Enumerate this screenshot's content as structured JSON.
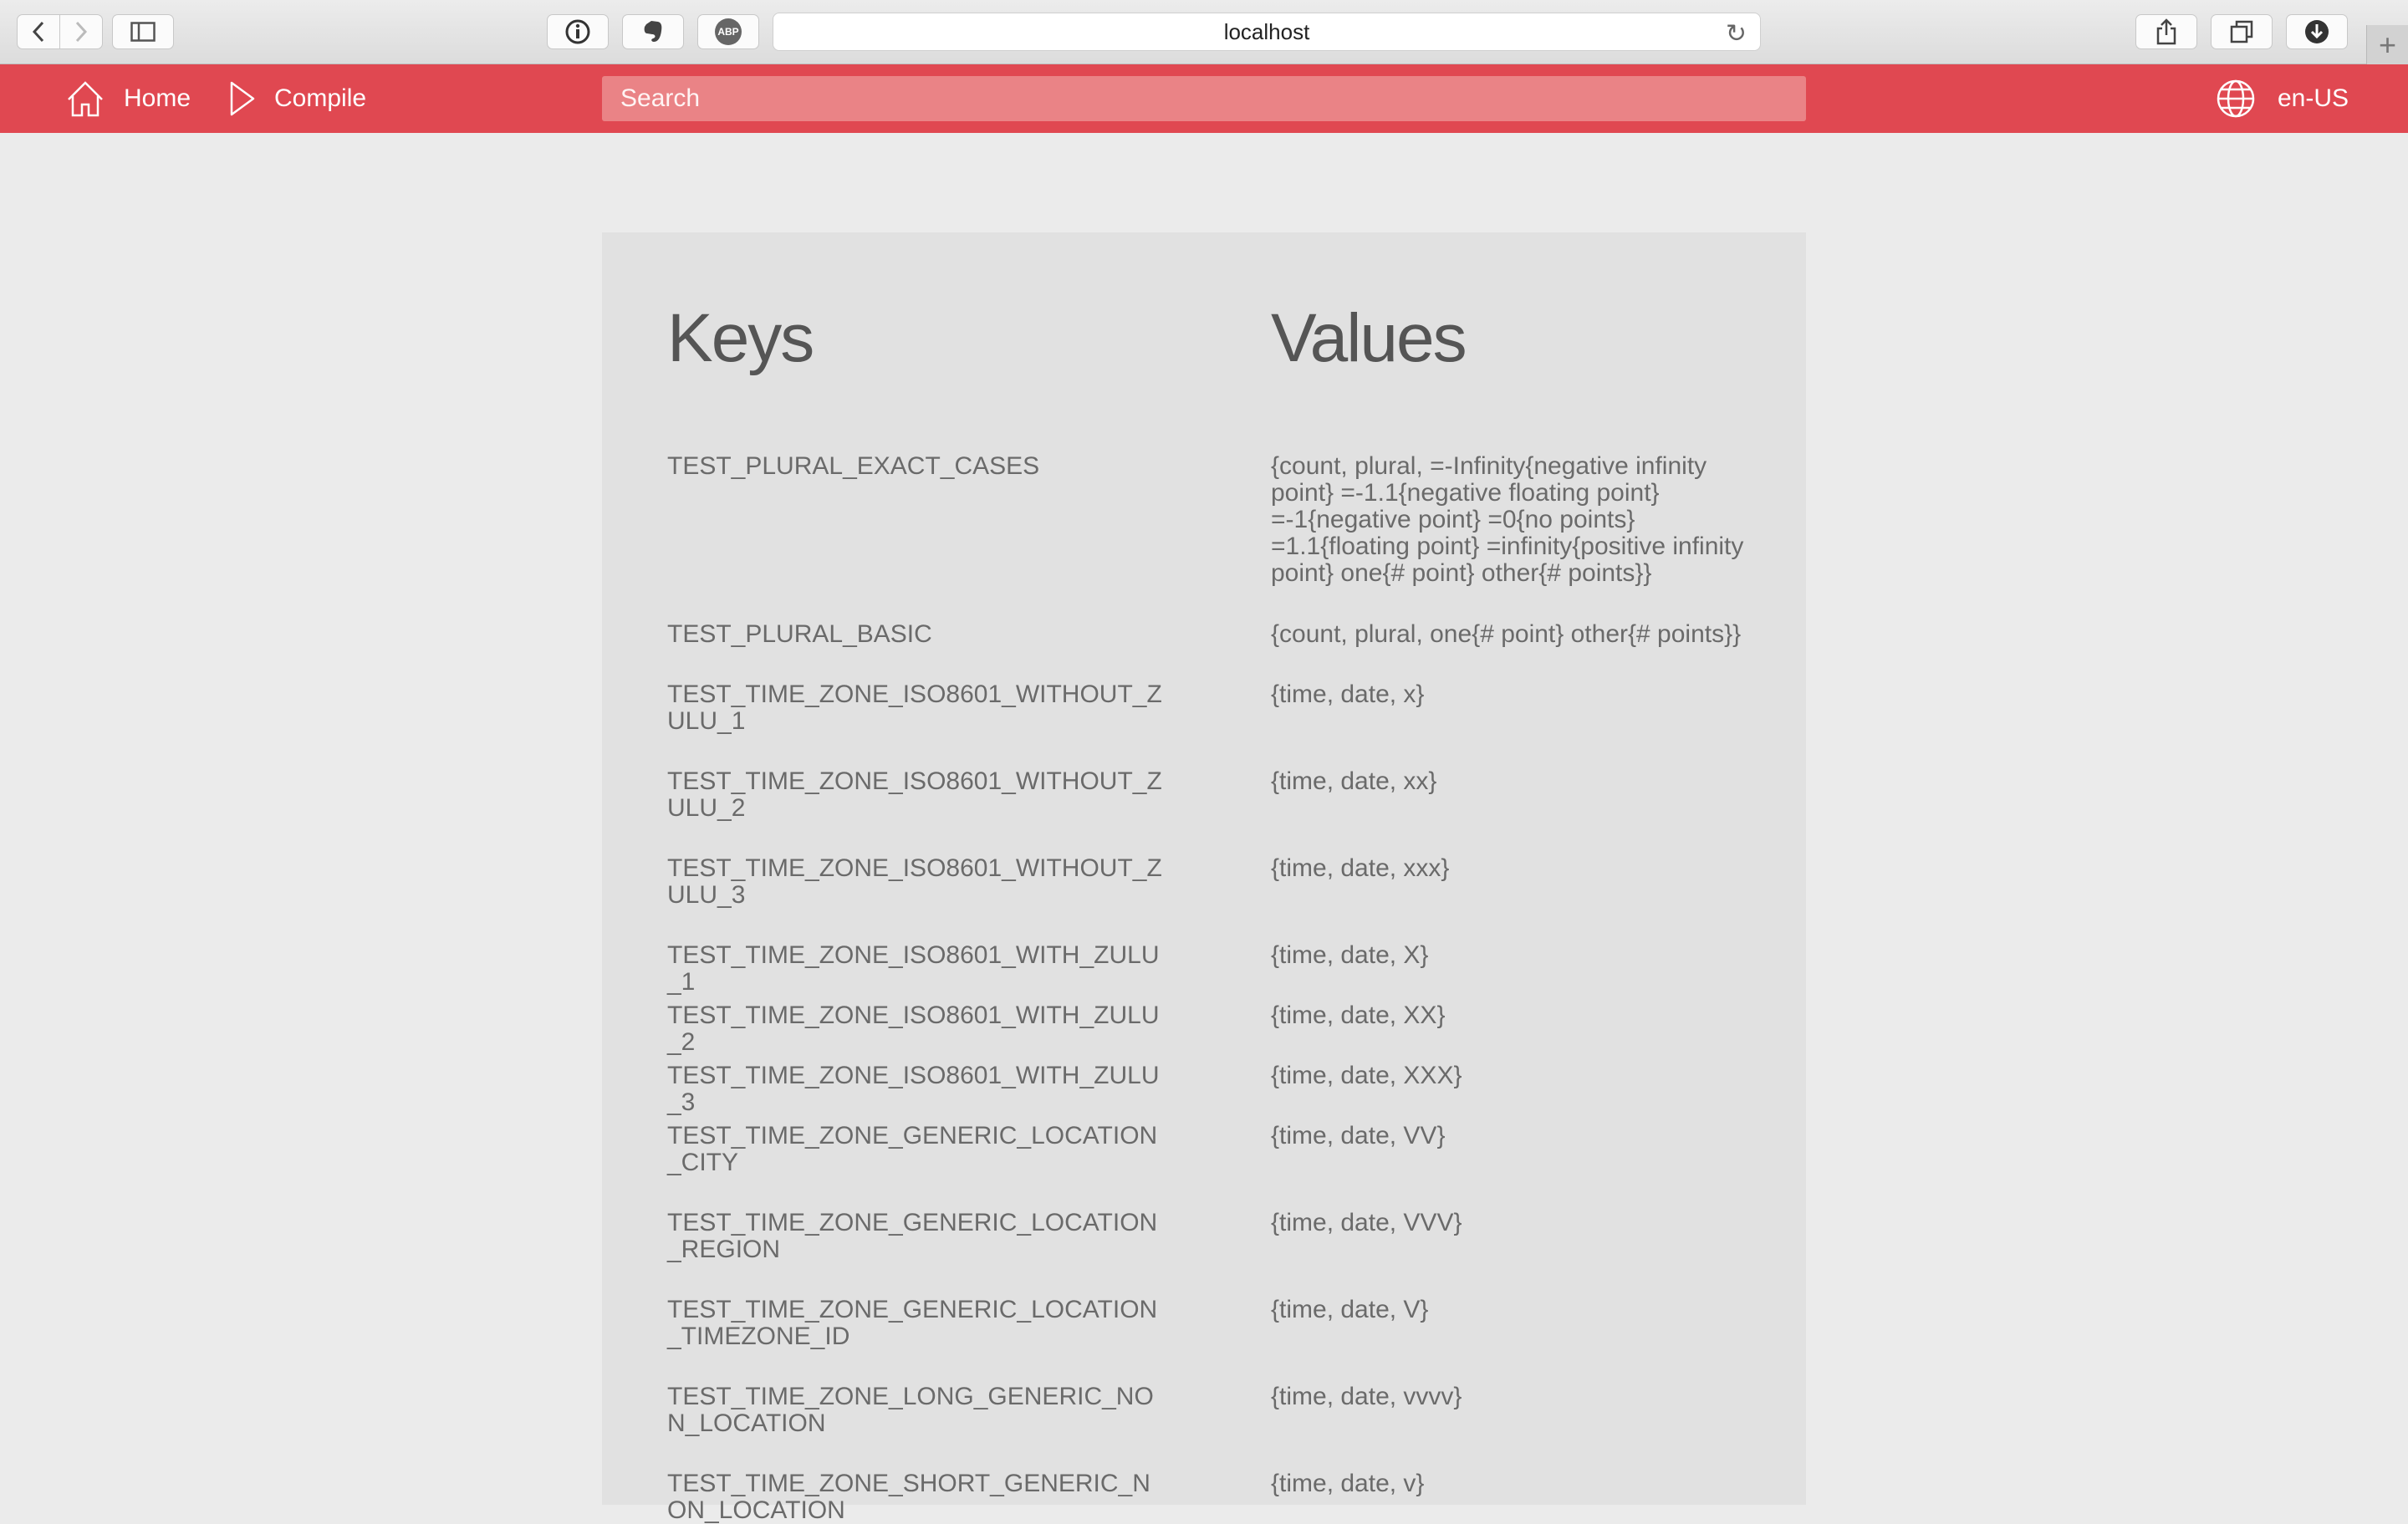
{
  "browser": {
    "address": "localhost",
    "adblock_label": "ABP"
  },
  "navbar": {
    "home_label": "Home",
    "compile_label": "Compile",
    "search_placeholder": "Search",
    "locale": "en-US"
  },
  "table": {
    "keys_header": "Keys",
    "values_header": "Values",
    "rows": [
      {
        "key": "TEST_PLURAL_EXACT_CASES",
        "value": "{count, plural, =-Infinity{negative infinity point} =-1.1{negative floating point} =-1{negative point} =0{no points} =1.1{floating point} =infinity{positive infinity point} one{# point} other{# points}}"
      },
      {
        "key": "TEST_PLURAL_BASIC",
        "value": "{count, plural, one{# point} other{# points}}"
      },
      {
        "key": "TEST_TIME_ZONE_ISO8601_WITHOUT_ZULU_1",
        "value": "{time, date, x}"
      },
      {
        "key": "TEST_TIME_ZONE_ISO8601_WITHOUT_ZULU_2",
        "value": "{time, date, xx}"
      },
      {
        "key": "TEST_TIME_ZONE_ISO8601_WITHOUT_ZULU_3",
        "value": "{time, date, xxx}"
      },
      {
        "key": "TEST_TIME_ZONE_ISO8601_WITH_ZULU_1",
        "value": "{time, date, X}"
      },
      {
        "key": "TEST_TIME_ZONE_ISO8601_WITH_ZULU_2",
        "value": "{time, date, XX}"
      },
      {
        "key": "TEST_TIME_ZONE_ISO8601_WITH_ZULU_3",
        "value": "{time, date, XXX}"
      },
      {
        "key": "TEST_TIME_ZONE_GENERIC_LOCATION_CITY",
        "value": "{time, date, VV}"
      },
      {
        "key": "TEST_TIME_ZONE_GENERIC_LOCATION_REGION",
        "value": "{time, date, VVV}"
      },
      {
        "key": "TEST_TIME_ZONE_GENERIC_LOCATION_TIMEZONE_ID",
        "value": "{time, date, V}"
      },
      {
        "key": "TEST_TIME_ZONE_LONG_GENERIC_NON_LOCATION",
        "value": "{time, date, vvvv}"
      },
      {
        "key": "TEST_TIME_ZONE_SHORT_GENERIC_NON_LOCATION",
        "value": "{time, date, v}"
      }
    ]
  }
}
